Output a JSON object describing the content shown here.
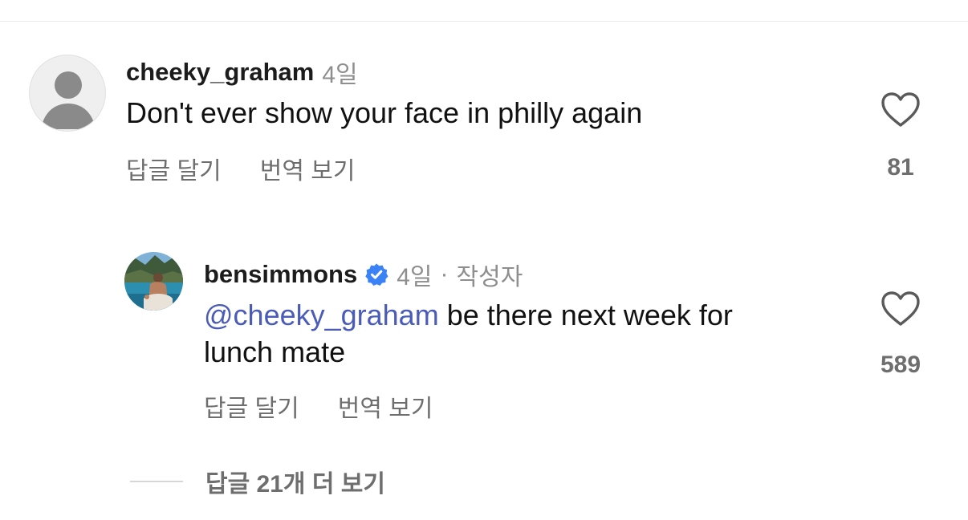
{
  "comments": [
    {
      "username": "cheeky_graham",
      "age": "4일",
      "text": "Don't ever show your face in philly again",
      "reply_label": "답글 달기",
      "translate_label": "번역 보기",
      "like_count": "81",
      "avatar": "default-person-icon"
    },
    {
      "username": "bensimmons",
      "verified": true,
      "age": "4일",
      "author_badge": "작성자",
      "mention": "@cheeky_graham",
      "text_line1_rest": " be there next week for",
      "text_line2": "lunch mate",
      "reply_label": "답글 달기",
      "translate_label": "번역 보기",
      "like_count": "589",
      "avatar": "profile-photo"
    }
  ],
  "view_more_replies": "답글 21개 더 보기",
  "colors": {
    "mention": "#4a5bb8",
    "muted": "#8e8e8e",
    "verified": "#3b82f6"
  },
  "icons": [
    "heart-outline-icon",
    "verified-badge-icon",
    "default-avatar-icon"
  ]
}
